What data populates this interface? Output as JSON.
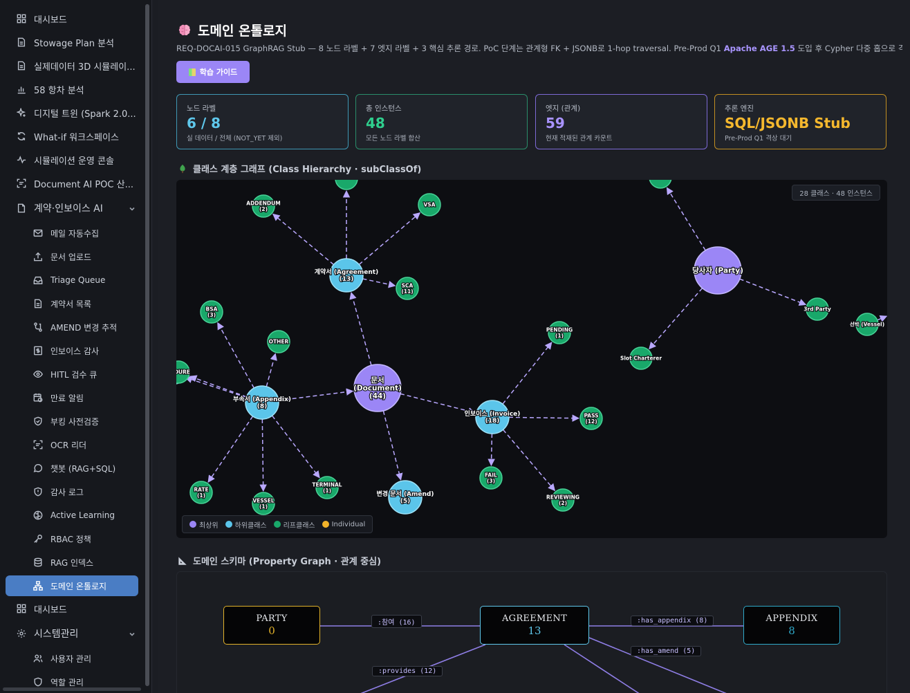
{
  "sidebar": {
    "items": [
      {
        "label": "대시보드",
        "icon": "grid-icon"
      },
      {
        "label": "Stowage Plan 분석",
        "icon": "document-icon"
      },
      {
        "label": "실제데이터 3D 시뮬레이...",
        "icon": "document-icon"
      },
      {
        "label": "58 항차 분석",
        "icon": "bar-chart-icon"
      },
      {
        "label": "디지털 트윈 (Spark 2.0...",
        "icon": "sparkle-icon"
      },
      {
        "label": "What-if 워크스페이스",
        "icon": "refresh-icon"
      },
      {
        "label": "시뮬레이션 운영 콘솔",
        "icon": "activity-icon"
      },
      {
        "label": "Document AI POC 산...",
        "icon": "scan-icon"
      }
    ],
    "group_contract": {
      "label": "계약·인보이스 AI",
      "icon": "document-icon"
    },
    "contract_items": [
      {
        "label": "메일 자동수집",
        "icon": "mail-icon"
      },
      {
        "label": "문서 업로드",
        "icon": "upload-icon"
      },
      {
        "label": "Triage Queue",
        "icon": "inbox-icon"
      },
      {
        "label": "계약서 목록",
        "icon": "document-icon"
      },
      {
        "label": "AMEND 변경 추적",
        "icon": "branch-icon"
      },
      {
        "label": "인보이스 감사",
        "icon": "dollar-icon"
      },
      {
        "label": "HITL 검수 큐",
        "icon": "eye-icon"
      },
      {
        "label": "만료 알림",
        "icon": "calendar-clock-icon"
      },
      {
        "label": "부킹 사전검증",
        "icon": "shield-check-icon"
      },
      {
        "label": "OCR 리더",
        "icon": "scan-text-icon"
      },
      {
        "label": "챗봇 (RAG+SQL)",
        "icon": "chat-icon"
      },
      {
        "label": "감사 로그",
        "icon": "shield-icon"
      },
      {
        "label": "Active Learning",
        "icon": "brain-icon"
      },
      {
        "label": "RBAC 정책",
        "icon": "key-icon"
      },
      {
        "label": "RAG 인덱스",
        "icon": "database-icon"
      },
      {
        "label": "도메인 온톨로지",
        "icon": "network-icon"
      }
    ],
    "bottom_dashboard": {
      "label": "대시보드",
      "icon": "grid-icon"
    },
    "group_system": {
      "label": "시스템관리",
      "icon": "gear-icon"
    },
    "system_items": [
      {
        "label": "사용자 관리",
        "icon": "users-icon"
      },
      {
        "label": "역할 관리",
        "icon": "shield-icon"
      }
    ]
  },
  "header": {
    "title": "도메인 온톨로지",
    "subtitle_pre": "REQ-DOCAI-015 GraphRAG Stub — 8 노드 라벨 + 7 엣지 라벨 + 3 핵심 추론 경로. PoC 단계는 관계형 FK + JSONB로 1-hop traversal. Pre-Prod Q1 ",
    "subtitle_hl": "Apache AGE 1.5",
    "subtitle_post": " 도입 후 Cypher 다중 홉으로 격상.",
    "guide_button": "학습 가이드"
  },
  "kpis": [
    {
      "label": "노드 라벨",
      "value": "6 / 8",
      "sub": "실 데이터 / 전체 (NOT_YET 제외)",
      "color": "#5fc8ec",
      "border": "#3f98b5"
    },
    {
      "label": "총 인스턴스",
      "value": "48",
      "sub": "모든 노드 라벨 합산",
      "color": "#2fcf8e",
      "border": "#2a8d6a"
    },
    {
      "label": "엣지 (관계)",
      "value": "59",
      "sub": "현재 적재된 관계 카운트",
      "color": "#a993ff",
      "border": "#7d6ad6"
    },
    {
      "label": "추론 엔진",
      "value": "SQL/JSONB Stub",
      "sub": "Pre-Prod Q1 격상 대기",
      "color": "#f5b82e",
      "border": "#c28f22"
    }
  ],
  "hierarchy": {
    "title": "클래스 계층 그래프 (Class Hierarchy · subClassOf)",
    "badge": "28 클래스 · 48 인스턴스",
    "legend": [
      {
        "label": "최상위",
        "color": "#9b86f6"
      },
      {
        "label": "하위클래스",
        "color": "#5bc5ea"
      },
      {
        "label": "리프클래스",
        "color": "#19a86a"
      },
      {
        "label": "Individual",
        "color": "#f2b32a"
      }
    ],
    "nodes": [
      {
        "id": "document",
        "label": "문서 (Document) (44)",
        "lines": [
          "문서",
          "(Document)",
          "(44)"
        ],
        "level": "top"
      },
      {
        "id": "party",
        "label": "당사자 (Party)",
        "lines": [
          "당사자 (Party)"
        ],
        "level": "top"
      },
      {
        "id": "agreement",
        "label": "계약서 (Agreement) (13)",
        "lines": [
          "계약서 (Agreement)",
          "(13)"
        ],
        "level": "sub"
      },
      {
        "id": "appendix",
        "label": "부속서 (Appendix) (8)",
        "lines": [
          "부속서 (Appendix)",
          "(8)"
        ],
        "level": "sub"
      },
      {
        "id": "invoice",
        "label": "인보이스 (Invoice) (18)",
        "lines": [
          "인보이스 (Invoice)",
          "(18)"
        ],
        "level": "sub"
      },
      {
        "id": "amend",
        "label": "변경 문서 (Amend) (5)",
        "lines": [
          "변경 문서 (Amend)",
          "(5)"
        ],
        "level": "sub"
      },
      {
        "id": "addendum",
        "label": "ADDENDUM (2)",
        "lines": [
          "ADDENDUM",
          "(2)"
        ],
        "level": "leaf"
      },
      {
        "id": "vsa",
        "label": "VSA",
        "lines": [
          "VSA"
        ],
        "level": "leaf"
      },
      {
        "id": "sca",
        "label": "SCA (11)",
        "lines": [
          "SCA",
          "(11)"
        ],
        "level": "leaf"
      },
      {
        "id": "bsa",
        "label": "BSA (3)",
        "lines": [
          "BSA",
          "(3)"
        ],
        "level": "leaf"
      },
      {
        "id": "other",
        "label": "OTHER",
        "lines": [
          "OTHER"
        ],
        "level": "leaf"
      },
      {
        "id": "procedure",
        "label": "CEDURE",
        "lines": [
          "CEDURE"
        ],
        "level": "leaf"
      },
      {
        "id": "rate",
        "label": "RATE (1)",
        "lines": [
          "RATE",
          "(1)"
        ],
        "level": "leaf"
      },
      {
        "id": "vessel_doc",
        "label": "VESSEL (1)",
        "lines": [
          "VESSEL",
          "(1)"
        ],
        "level": "leaf"
      },
      {
        "id": "terminal",
        "label": "TERMINAL (1)",
        "lines": [
          "TERMINAL",
          "(1)"
        ],
        "level": "leaf"
      },
      {
        "id": "pending",
        "label": "PENDING (1)",
        "lines": [
          "PENDING",
          "(1)"
        ],
        "level": "leaf"
      },
      {
        "id": "pass",
        "label": "PASS (12)",
        "lines": [
          "PASS",
          "(12)"
        ],
        "level": "leaf"
      },
      {
        "id": "fail",
        "label": "FAIL (3)",
        "lines": [
          "FAIL",
          "(3)"
        ],
        "level": "leaf"
      },
      {
        "id": "reviewing",
        "label": "REVIEWING (2)",
        "lines": [
          "REVIEWING",
          "(2)"
        ],
        "level": "leaf"
      },
      {
        "id": "slot",
        "label": "Slot Charterer",
        "lines": [
          "Slot Charterer"
        ],
        "level": "leaf"
      },
      {
        "id": "third",
        "label": "3rd Party",
        "lines": [
          "3rd Party"
        ],
        "level": "leaf"
      },
      {
        "id": "vessel",
        "label": "선박 (Vessel)",
        "lines": [
          "선박 (Vessel)"
        ],
        "level": "leaf"
      }
    ]
  },
  "schema": {
    "title": "도메인 스키마 (Property Graph · 관계 중심)",
    "nodes": [
      {
        "name": "PARTY",
        "count": "0",
        "color": "#e2b22a"
      },
      {
        "name": "AGREEMENT",
        "count": "13",
        "color": "#5fc8ec"
      },
      {
        "name": "APPENDIX",
        "count": "8",
        "color": "#2fa9c9"
      }
    ],
    "edges": [
      ":참여 (16)",
      ":has_appendix (8)",
      ":has_amend (5)",
      ":provides (12)"
    ]
  },
  "colors": {
    "accent": "#9b86f6",
    "active_nav": "#4a7dc4",
    "edge": "#b9a8ff"
  }
}
